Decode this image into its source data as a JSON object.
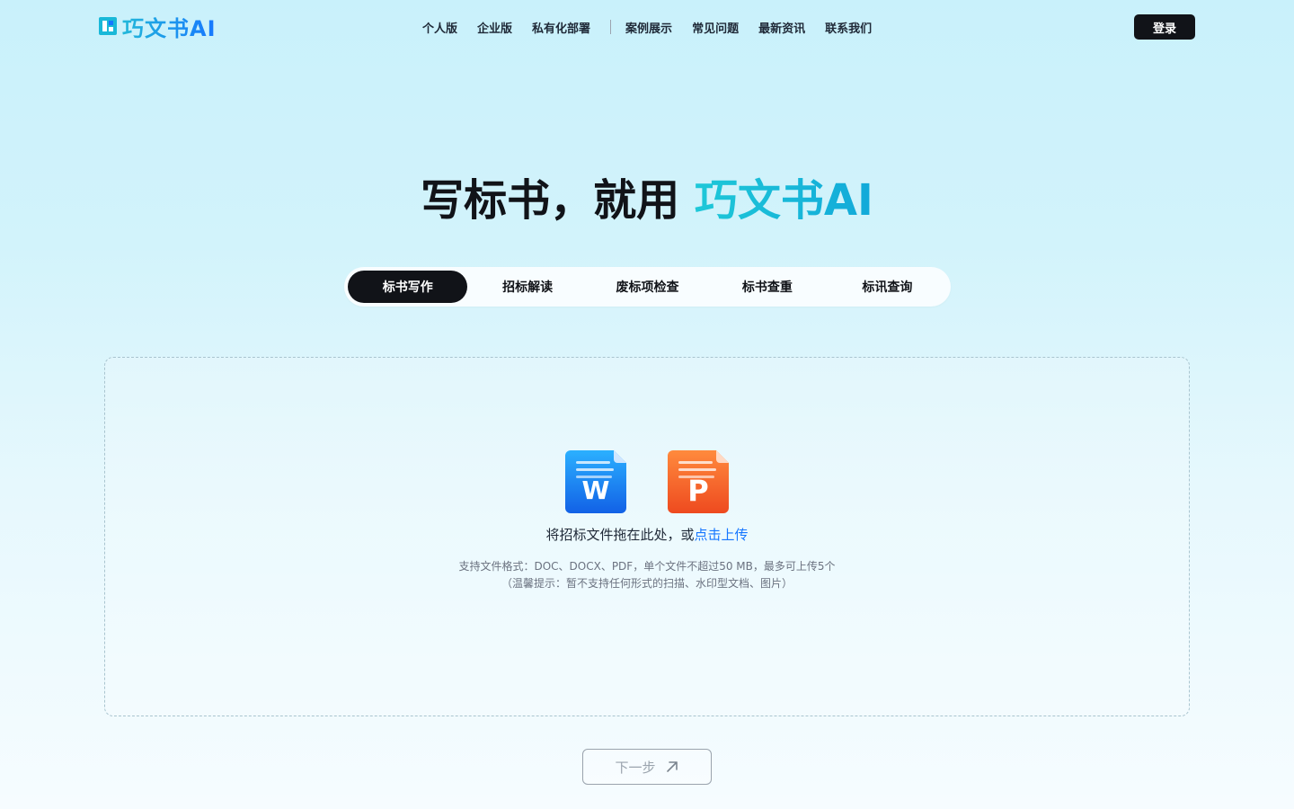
{
  "header": {
    "logo_text": "巧文书AI",
    "nav": [
      {
        "label": "个人版"
      },
      {
        "label": "企业版"
      },
      {
        "label": "私有化部署"
      },
      {
        "label": "案例展示"
      },
      {
        "label": "常见问题"
      },
      {
        "label": "最新资讯"
      },
      {
        "label": "联系我们"
      }
    ],
    "login_label": "登录"
  },
  "hero": {
    "title_prefix": "写标书，就用",
    "title_accent": "巧文书AI"
  },
  "tabs": [
    {
      "label": "标书写作",
      "active": true
    },
    {
      "label": "招标解读",
      "active": false
    },
    {
      "label": "废标项检查",
      "active": false
    },
    {
      "label": "标书查重",
      "active": false
    },
    {
      "label": "标讯查询",
      "active": false
    }
  ],
  "upload": {
    "icons": [
      "word-file-icon",
      "ppt-file-icon"
    ],
    "drop_text": "将招标文件拖在此处，或",
    "link_text": "点击上传",
    "hint_formats": "支持文件格式：DOC、DOCX、PDF，单个文件不超过50 MB，最多可上传5个",
    "hint_warning": "（温馨提示：暂不支持任何形式的扫描、水印型文档、图片）"
  },
  "next_button": {
    "label": "下一步",
    "icon": "arrow-up-right-icon"
  },
  "colors": {
    "accent": "#1ec8d8",
    "link": "#1677ff",
    "dark": "#111318",
    "word_blue": "#1e88f0",
    "ppt_orange": "#f2622e"
  }
}
